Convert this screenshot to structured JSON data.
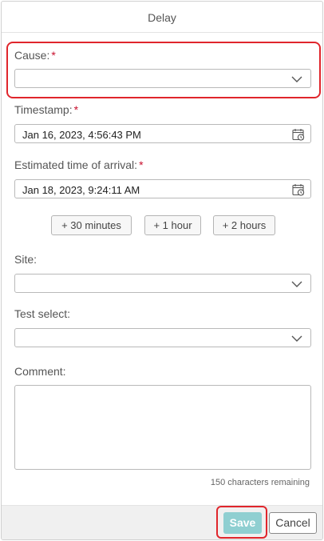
{
  "dialog": {
    "title": "Delay"
  },
  "cause": {
    "label": "Cause:",
    "required_mark": "*",
    "value": ""
  },
  "timestamp": {
    "label": "Timestamp:",
    "required_mark": "*",
    "value": "Jan 16, 2023, 4:56:43 PM"
  },
  "eta": {
    "label": "Estimated time of arrival:",
    "required_mark": "*",
    "value": "Jan 18, 2023, 9:24:11 AM"
  },
  "quick_buttons": [
    "+ 30 minutes",
    "+ 1 hour",
    "+ 2 hours"
  ],
  "site": {
    "label": "Site:",
    "value": ""
  },
  "test_select": {
    "label": "Test select:",
    "value": ""
  },
  "comment": {
    "label": "Comment:",
    "value": "",
    "remaining": "150 characters remaining"
  },
  "footer": {
    "save_label": "Save",
    "cancel_label": "Cancel"
  },
  "icons": {
    "dropdown": "chevron-down-icon",
    "date": "calendar-clock-icon"
  },
  "colors": {
    "required": "#c8102e",
    "highlight": "#e0262c",
    "save_bg": "#8fcfd1"
  }
}
